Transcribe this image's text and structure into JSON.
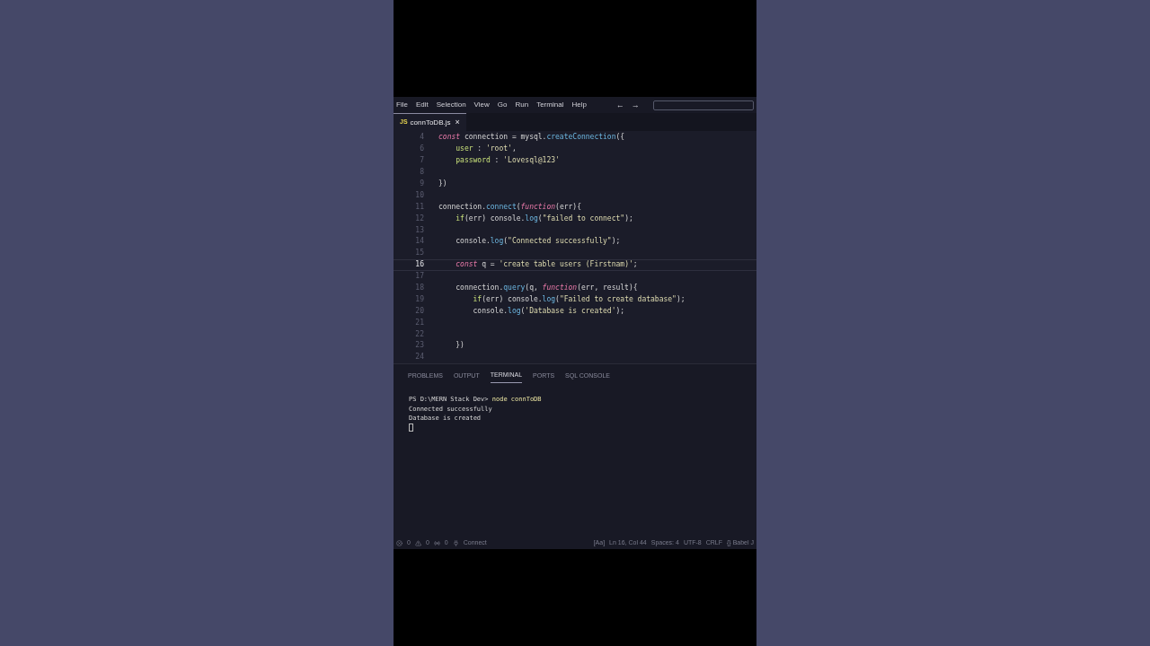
{
  "menu": [
    "File",
    "Edit",
    "Selection",
    "View",
    "Go",
    "Run",
    "Terminal",
    "Help"
  ],
  "nav": [
    "←",
    "→"
  ],
  "tabs": [
    {
      "icon": "JS",
      "label": "connToDB.js",
      "close": "×",
      "selected": true
    }
  ],
  "editor": {
    "lines": [
      {
        "number": "4",
        "current": false,
        "tokens": [
          {
            "text": "const",
            "kind": "kw"
          },
          {
            "text": " connection = mysql.",
            "kind": "plain"
          },
          {
            "text": "createConnection",
            "kind": "fn"
          },
          {
            "text": "({",
            "kind": "plain"
          }
        ]
      },
      {
        "number": "6",
        "current": false,
        "tokens": [
          {
            "text": "    user",
            "kind": "prop"
          },
          {
            "text": " : ",
            "kind": "plain"
          },
          {
            "text": "'root'",
            "kind": "str"
          },
          {
            "text": ",",
            "kind": "plain"
          }
        ]
      },
      {
        "number": "7",
        "current": false,
        "tokens": [
          {
            "text": "    password",
            "kind": "prop"
          },
          {
            "text": " : ",
            "kind": "plain"
          },
          {
            "text": "'Lovesql@123'",
            "kind": "str"
          }
        ]
      },
      {
        "number": "8",
        "current": false
      },
      {
        "number": "9",
        "current": false,
        "tokens": [
          {
            "text": "})",
            "kind": "plain"
          }
        ]
      },
      {
        "number": "10",
        "current": false
      },
      {
        "number": "11",
        "current": false,
        "tokens": [
          {
            "text": "connection.",
            "kind": "plain"
          },
          {
            "text": "connect",
            "kind": "fn"
          },
          {
            "text": "(",
            "kind": "plain"
          },
          {
            "text": "function",
            "kind": "kw"
          },
          {
            "text": "(err){",
            "kind": "plain"
          }
        ]
      },
      {
        "number": "12",
        "current": false,
        "tokens": [
          {
            "text": "    if",
            "kind": "prop"
          },
          {
            "text": "(err) console.",
            "kind": "plain"
          },
          {
            "text": "log",
            "kind": "fn"
          },
          {
            "text": "(",
            "kind": "plain"
          },
          {
            "text": "\"failed to connect\"",
            "kind": "str"
          },
          {
            "text": ");",
            "kind": "plain"
          }
        ]
      },
      {
        "number": "13",
        "current": false
      },
      {
        "number": "14",
        "current": false,
        "tokens": [
          {
            "text": "    console.",
            "kind": "plain"
          },
          {
            "text": "log",
            "kind": "fn"
          },
          {
            "text": "(",
            "kind": "plain"
          },
          {
            "text": "\"Connected successfully\"",
            "kind": "str"
          },
          {
            "text": ");",
            "kind": "plain"
          }
        ]
      },
      {
        "number": "15",
        "current": false
      },
      {
        "number": "16",
        "current": true,
        "tokens": [
          {
            "text": "    const",
            "kind": "kw"
          },
          {
            "text": " q = ",
            "kind": "plain"
          },
          {
            "text": "'create table users (Firstnam)'",
            "kind": "str"
          },
          {
            "text": ";",
            "kind": "plain"
          }
        ]
      },
      {
        "number": "17",
        "current": false
      },
      {
        "number": "18",
        "current": false,
        "tokens": [
          {
            "text": "    connection.",
            "kind": "plain"
          },
          {
            "text": "query",
            "kind": "fn"
          },
          {
            "text": "(q, ",
            "kind": "plain"
          },
          {
            "text": "function",
            "kind": "kw"
          },
          {
            "text": "(err, result){",
            "kind": "plain"
          }
        ]
      },
      {
        "number": "19",
        "current": false,
        "tokens": [
          {
            "text": "        if",
            "kind": "prop"
          },
          {
            "text": "(err) console.",
            "kind": "plain"
          },
          {
            "text": "log",
            "kind": "fn"
          },
          {
            "text": "(",
            "kind": "plain"
          },
          {
            "text": "\"Failed to create database\"",
            "kind": "str"
          },
          {
            "text": ");",
            "kind": "plain"
          }
        ]
      },
      {
        "number": "20",
        "current": false,
        "tokens": [
          {
            "text": "        console.",
            "kind": "plain"
          },
          {
            "text": "log",
            "kind": "fn"
          },
          {
            "text": "(",
            "kind": "plain"
          },
          {
            "text": "'Database is created'",
            "kind": "str"
          },
          {
            "text": ");",
            "kind": "plain"
          }
        ]
      },
      {
        "number": "21",
        "current": false
      },
      {
        "number": "22",
        "current": false
      },
      {
        "number": "23",
        "current": false,
        "tokens": [
          {
            "text": "    })",
            "kind": "plain"
          }
        ]
      },
      {
        "number": "24",
        "current": false
      }
    ]
  },
  "panel_tabs": [
    {
      "label": "PROBLEMS",
      "selected": false
    },
    {
      "label": "OUTPUT",
      "selected": false
    },
    {
      "label": "TERMINAL",
      "selected": true
    },
    {
      "label": "PORTS",
      "selected": false
    },
    {
      "label": "SQL CONSOLE",
      "selected": false
    }
  ],
  "terminal": {
    "prompt": "PS D:\\MERN Stack Dev>",
    "command": "node connToDB",
    "output": [
      "Connected successfully",
      "Database is created"
    ]
  },
  "status_bar": {
    "errors": "0",
    "warnings": "0",
    "ports": "0",
    "connect": "Connect",
    "items": [
      "[Aa]",
      "Ln 16, Col 44",
      "Spaces: 4",
      "UTF-8",
      "CRLF",
      "{} Babel J"
    ]
  }
}
